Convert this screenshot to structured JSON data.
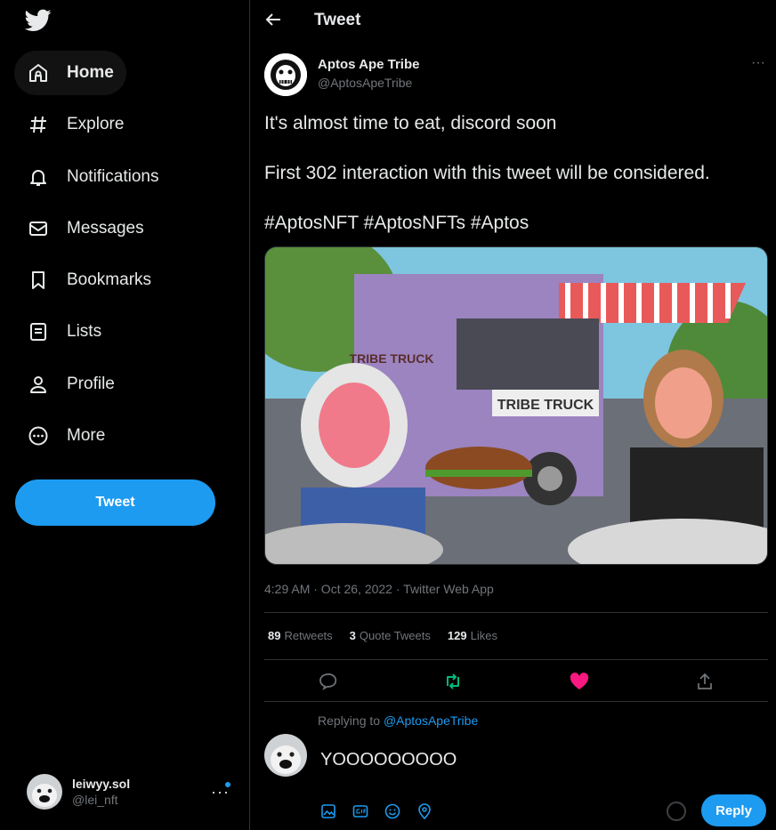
{
  "sidebar": {
    "items": [
      {
        "label": "Home",
        "icon": "home-icon"
      },
      {
        "label": "Explore",
        "icon": "hashtag-icon"
      },
      {
        "label": "Notifications",
        "icon": "bell-icon"
      },
      {
        "label": "Messages",
        "icon": "envelope-icon"
      },
      {
        "label": "Bookmarks",
        "icon": "bookmark-icon"
      },
      {
        "label": "Lists",
        "icon": "list-icon"
      },
      {
        "label": "Profile",
        "icon": "person-icon"
      },
      {
        "label": "More",
        "icon": "more-circle-icon"
      }
    ],
    "tweet_button": "Tweet",
    "account": {
      "name": "leiwyy.sol",
      "handle": "@lei_nft"
    }
  },
  "header": {
    "title": "Tweet"
  },
  "tweet": {
    "author_name": "Aptos Ape Tribe",
    "author_handle": "@AptosApeTribe",
    "line1": "It's almost time to eat, discord soon",
    "line2": "First 302 interaction with this tweet will be considered.",
    "line3": "#AptosNFT #AptosNFTs #Aptos",
    "image_text": {
      "sign": "TRIBE TRUCK",
      "logo": "TRIBE TRUCK"
    },
    "meta": "4:29 AM · Oct 26, 2022 · Twitter Web App",
    "stats": [
      {
        "count": "89",
        "label": "Retweets"
      },
      {
        "count": "3",
        "label": "Quote Tweets"
      },
      {
        "count": "129",
        "label": "Likes"
      }
    ]
  },
  "reply": {
    "replying_prefix": "Replying to",
    "replying_mention": "@AptosApeTribe",
    "text": "YOOOOOOOOO",
    "button": "Reply"
  },
  "colors": {
    "accent": "#1d9bf0",
    "like": "#f91880",
    "retweet": "#00ba7c",
    "background": "#000000"
  }
}
